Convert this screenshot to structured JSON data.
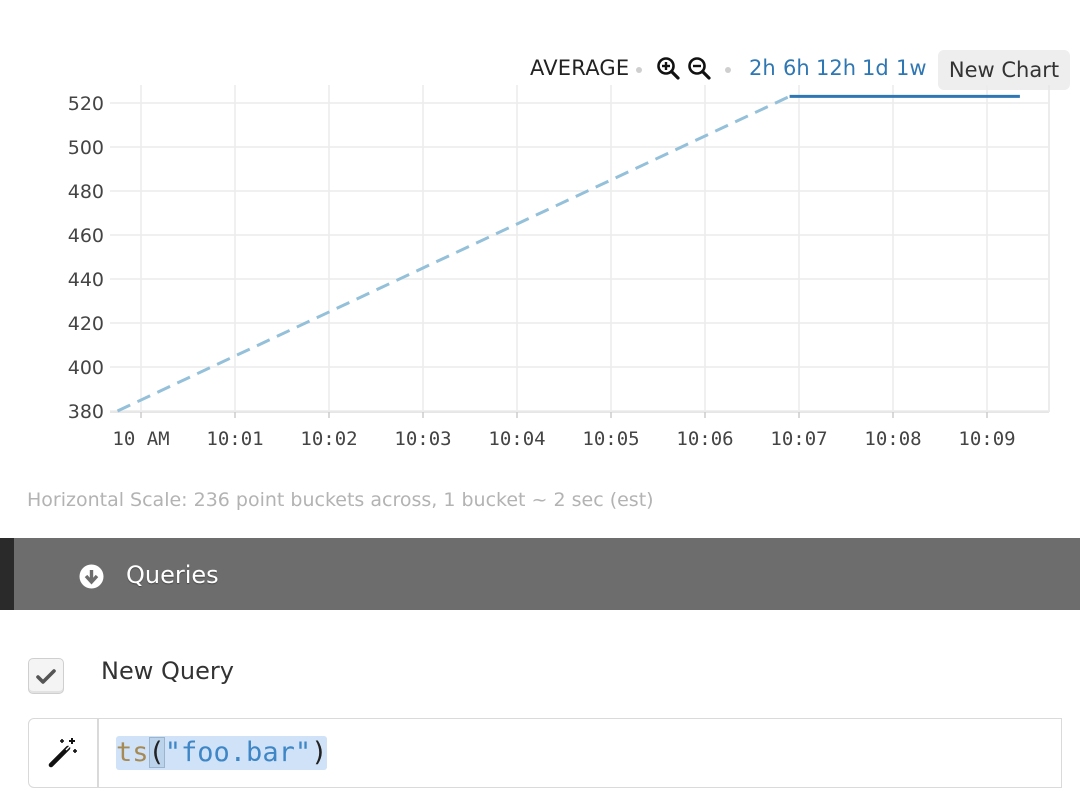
{
  "toolbar": {
    "aggregation": "AVERAGE",
    "zoom_in_icon": "zoom-in-icon",
    "zoom_out_icon": "zoom-out-icon",
    "ranges": [
      "2h",
      "6h",
      "12h",
      "1d",
      "1w"
    ],
    "new_chart_label": "New Chart"
  },
  "chart_data": {
    "type": "line",
    "x_tick_labels": [
      "10 AM",
      "10:01",
      "10:02",
      "10:03",
      "10:04",
      "10:05",
      "10:06",
      "10:07",
      "10:08",
      "10:09"
    ],
    "y_tick_labels": [
      "520",
      "500",
      "480",
      "460",
      "440",
      "420",
      "400",
      "380"
    ],
    "ylim": [
      380,
      520
    ],
    "xlim_minutes_after_10am": [
      -0.3,
      9.65
    ],
    "grid": true,
    "series": [
      {
        "style": "dashed",
        "color": "#94c0da",
        "points": [
          {
            "x": -0.25,
            "y": 380
          },
          {
            "x": 6.9,
            "y": 523
          }
        ]
      },
      {
        "style": "solid",
        "color": "#2f77b3",
        "points": [
          {
            "x": 6.9,
            "y": 523
          },
          {
            "x": 9.35,
            "y": 523
          }
        ]
      }
    ]
  },
  "scale_note": "Horizontal Scale: 236 point buckets across, 1 bucket ~ 2 sec (est)",
  "queries_section": {
    "title": "Queries",
    "toggle_icon": "arrow-circle-down-icon",
    "colors": {
      "bar": "#6d6d6d",
      "edge": "#2a2a2a"
    }
  },
  "query": {
    "name": "New Query",
    "enabled": true,
    "wand_icon": "magic-wand-icon",
    "expression": {
      "fn": "ts",
      "open": "(",
      "arg": "\"foo.bar\"",
      "close": ")"
    }
  },
  "colors": {
    "accent": "#2f77b3",
    "dashed_series": "#94c0da",
    "selection": "#cfe2f7"
  }
}
